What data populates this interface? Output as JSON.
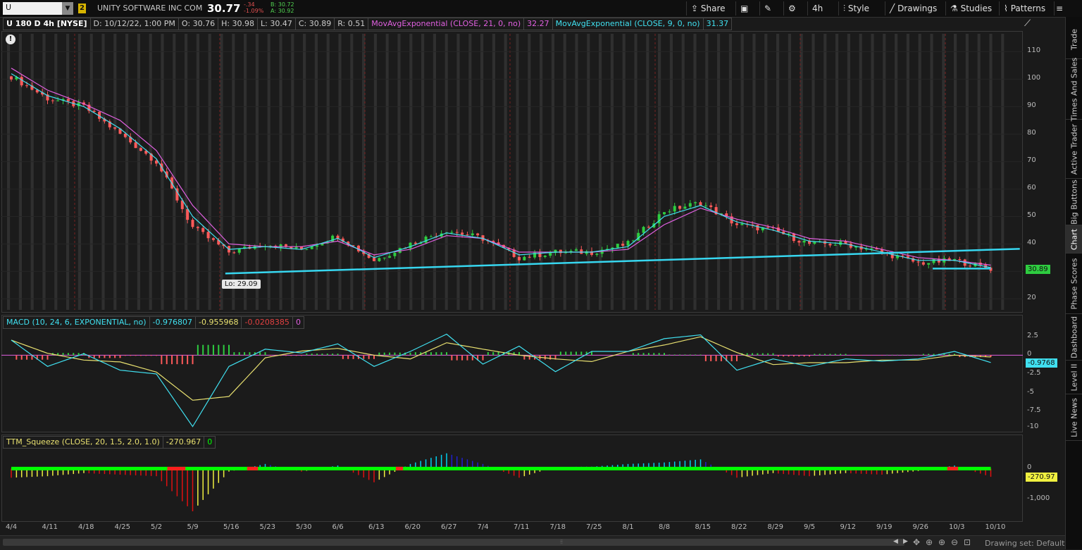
{
  "toolbar": {
    "symbol": "U",
    "link_badge": "2",
    "company": "UNITY SOFTWARE INC COM",
    "last": "30.77",
    "change": "-.34",
    "change_pct": "-1.09%",
    "bid": "B: 30.72",
    "ask": "A: 30.92",
    "share": "Share",
    "timeframe": "4h",
    "style": "Style",
    "drawings": "Drawings",
    "studies": "Studies",
    "patterns": "Patterns"
  },
  "infobar": {
    "title": "U 180 D 4h [NYSE]",
    "date": "D: 10/12/22, 1:00 PM",
    "open": "O: 30.76",
    "high": "H: 30.98",
    "low": "L: 30.47",
    "close": "C: 30.89",
    "range": "R: 0.51",
    "ema21_label": "MovAvgExponential (CLOSE, 21, 0, no)",
    "ema21_value": "32.27",
    "ema9_label": "MovAvgExponential (CLOSE, 9, 0, no)",
    "ema9_value": "31.37"
  },
  "price_pane": {
    "y_ticks": [
      "110",
      "100",
      "90",
      "80",
      "70",
      "60",
      "50",
      "40",
      "30",
      "20"
    ],
    "low_label": "Lo: 29.09",
    "last_tag": "30.89",
    "alert_icon": "!"
  },
  "macd_pane": {
    "title": "MACD (10, 24, 6, EXPONENTIAL, no)",
    "value": "-0.976807",
    "avg": "-0.955968",
    "diff": "-0.0208385",
    "zero": "0",
    "y_ticks": [
      "2.5",
      "0",
      "-2.5",
      "-5",
      "-7.5",
      "-10"
    ],
    "last_tag": "-0.9768"
  },
  "squeeze_pane": {
    "title": "TTM_Squeeze (CLOSE, 20, 1.5, 2.0, 1.0)",
    "value": "-270.967",
    "zero": "0",
    "y_ticks": [
      "0",
      "-1,000"
    ],
    "last_tag": "-270.97"
  },
  "x_axis": [
    "4/4",
    "4/11",
    "4/18",
    "4/25",
    "5/2",
    "5/9",
    "5/16",
    "5/23",
    "5/30",
    "6/6",
    "6/13",
    "6/20",
    "6/27",
    "7/4",
    "7/11",
    "7/18",
    "7/25",
    "8/1",
    "8/8",
    "8/15",
    "8/22",
    "8/29",
    "9/5",
    "9/12",
    "9/19",
    "9/26",
    "10/3",
    "10/10"
  ],
  "sidebar_tabs": [
    "Trade",
    "Times And Sales",
    "Active Trader",
    "Big Buttons",
    "Chart",
    "Phase Scores",
    "Dashboard",
    "Level II",
    "Live News"
  ],
  "bottom": {
    "drawing_set": "Drawing set: Default"
  },
  "colors": {
    "bull": "#2ecc40",
    "bear": "#ff5a5a",
    "ema9": "#40e0f0",
    "ema21": "#e060e0",
    "trendline": "#37d7f0",
    "squeeze_on": "#ff1e1e",
    "squeeze_off": "#00ff00"
  },
  "chart_data": {
    "type": "candlestick",
    "title": "U 180 D 4h [NYSE]",
    "x": [
      "4/4",
      "4/11",
      "4/18",
      "4/25",
      "5/2",
      "5/9",
      "5/16",
      "5/23",
      "5/30",
      "6/6",
      "6/13",
      "6/20",
      "6/27",
      "7/4",
      "7/11",
      "7/18",
      "7/25",
      "8/1",
      "8/8",
      "8/15",
      "8/22",
      "8/29",
      "9/5",
      "9/12",
      "9/19",
      "9/26",
      "10/3",
      "10/10"
    ],
    "close_weekly": [
      101,
      93,
      90,
      80,
      70,
      46,
      37,
      40,
      38,
      43,
      34,
      40,
      45,
      42,
      35,
      37,
      37,
      40,
      52,
      55,
      47,
      45,
      40,
      40,
      37,
      33,
      34,
      31
    ],
    "ema9_weekly": [
      102,
      94,
      90,
      82,
      71,
      50,
      38,
      39,
      38,
      42,
      35,
      39,
      44,
      42,
      36,
      37,
      37,
      39,
      50,
      54,
      48,
      45,
      41,
      40,
      37,
      34,
      34,
      31.37
    ],
    "ema21_weekly": [
      104,
      96,
      91,
      85,
      74,
      54,
      40,
      39,
      39,
      41,
      36,
      38,
      43,
      42,
      37,
      37,
      37,
      38,
      47,
      53,
      49,
      46,
      42,
      41,
      38,
      35,
      34,
      32.27
    ],
    "ylim": [
      17,
      116
    ],
    "macd_weekly": [
      2,
      -1.5,
      0.2,
      -2,
      -2.5,
      -9.5,
      -1.5,
      0.8,
      0.3,
      1.5,
      -1.5,
      0.5,
      2.8,
      -1.2,
      1.2,
      -2.2,
      0.5,
      0.5,
      2.2,
      2.7,
      -2,
      -0.5,
      -1.5,
      -0.5,
      -0.8,
      -0.5,
      0.5,
      -0.98
    ],
    "macd_ylim": [
      -10,
      3.5
    ],
    "squeeze_weekly": [
      -300,
      -250,
      -150,
      -200,
      -250,
      -1400,
      -100,
      150,
      -100,
      100,
      -450,
      150,
      500,
      150,
      -300,
      50,
      60,
      150,
      200,
      300,
      -300,
      -150,
      -250,
      -150,
      -200,
      -80,
      100,
      -271
    ],
    "squeeze_ylim": [
      -1700,
      700
    ],
    "trendline_points": [
      [
        5.9,
        29.2
      ],
      [
        27.8,
        38.2
      ]
    ],
    "support_points": [
      [
        25.4,
        31.0
      ],
      [
        27.0,
        31.0
      ]
    ],
    "low_marker": {
      "x": 5.9,
      "value": 29.09
    }
  }
}
